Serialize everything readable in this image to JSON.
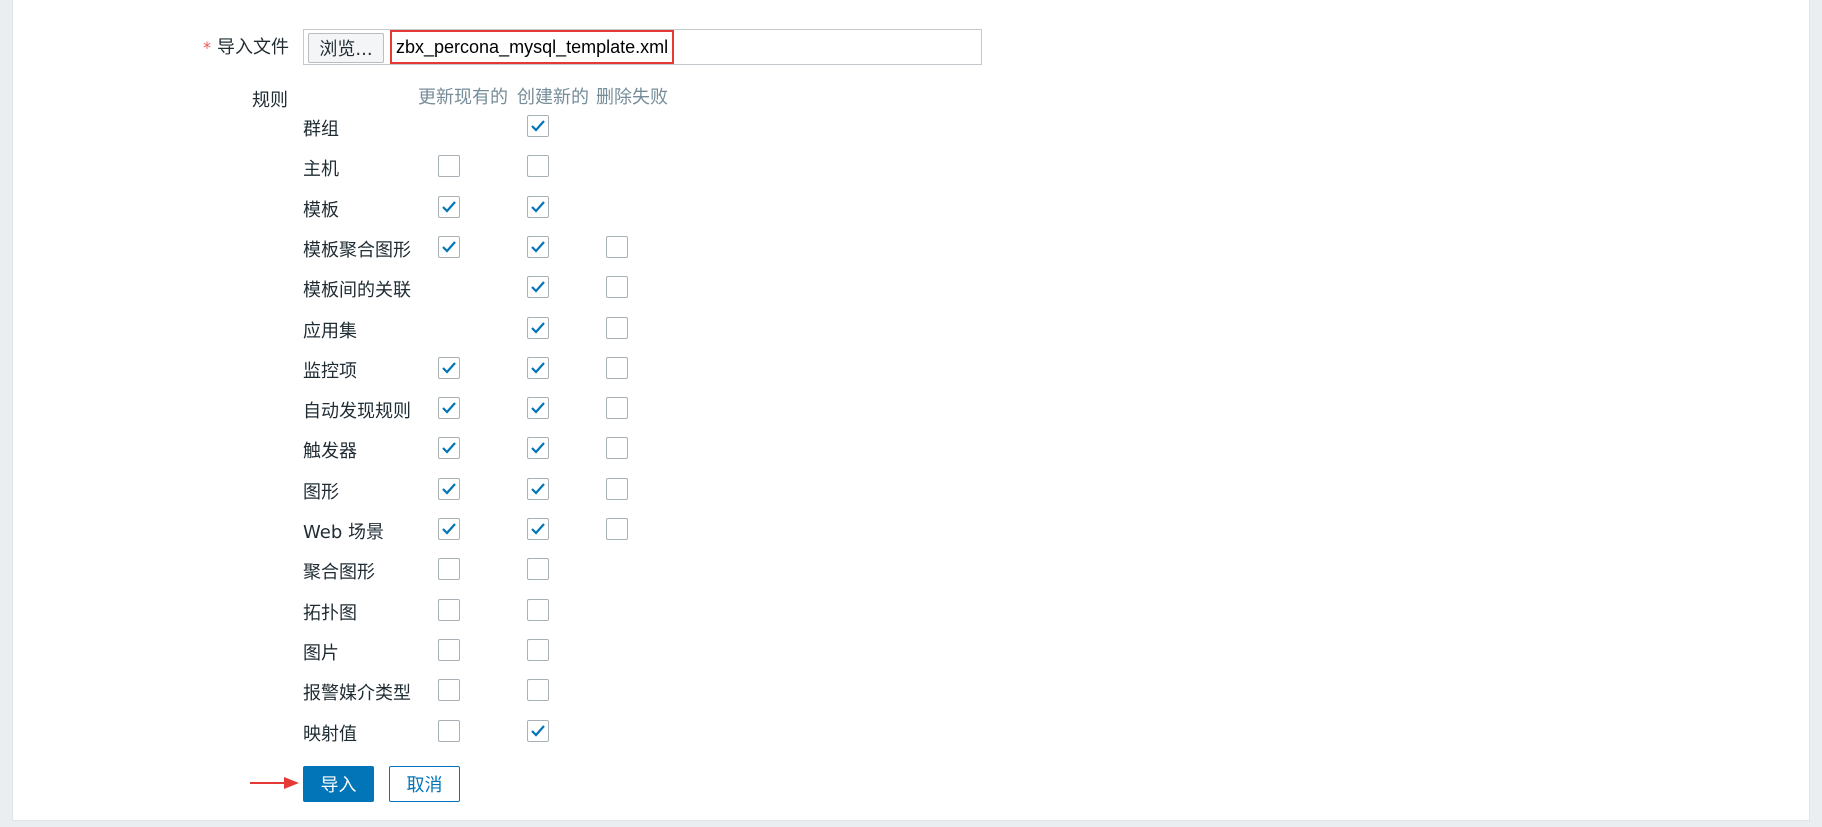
{
  "form": {
    "import_file": {
      "required_mark": "*",
      "label": "导入文件",
      "browse_label": "浏览...",
      "file_name": "zbx_percona_mysql_template.xml"
    },
    "rules_label": "规则",
    "columns": [
      "更新现有的",
      "创建新的",
      "删除失败"
    ],
    "rules": [
      {
        "label": "群组",
        "update": null,
        "create": true,
        "delete": null
      },
      {
        "label": "主机",
        "update": false,
        "create": false,
        "delete": null
      },
      {
        "label": "模板",
        "update": true,
        "create": true,
        "delete": null
      },
      {
        "label": "模板聚合图形",
        "update": true,
        "create": true,
        "delete": false
      },
      {
        "label": "模板间的关联",
        "update": null,
        "create": true,
        "delete": false
      },
      {
        "label": "应用集",
        "update": null,
        "create": true,
        "delete": false
      },
      {
        "label": "监控项",
        "update": true,
        "create": true,
        "delete": false
      },
      {
        "label": "自动发现规则",
        "update": true,
        "create": true,
        "delete": false
      },
      {
        "label": "触发器",
        "update": true,
        "create": true,
        "delete": false
      },
      {
        "label": "图形",
        "update": true,
        "create": true,
        "delete": false
      },
      {
        "label": "Web 场景",
        "update": true,
        "create": true,
        "delete": false
      },
      {
        "label": "聚合图形",
        "update": false,
        "create": false,
        "delete": null
      },
      {
        "label": "拓扑图",
        "update": false,
        "create": false,
        "delete": null
      },
      {
        "label": "图片",
        "update": false,
        "create": false,
        "delete": null
      },
      {
        "label": "报警媒介类型",
        "update": false,
        "create": false,
        "delete": null
      },
      {
        "label": "映射值",
        "update": false,
        "create": true,
        "delete": null
      }
    ],
    "buttons": {
      "import_label": "导入",
      "cancel_label": "取消"
    }
  },
  "colors": {
    "accent": "#0275b8",
    "highlight": "#e53935",
    "checkmark": "#0275b8"
  },
  "icons": {
    "checkbox_checked": "check-icon",
    "annotation": "arrow-right-icon"
  }
}
